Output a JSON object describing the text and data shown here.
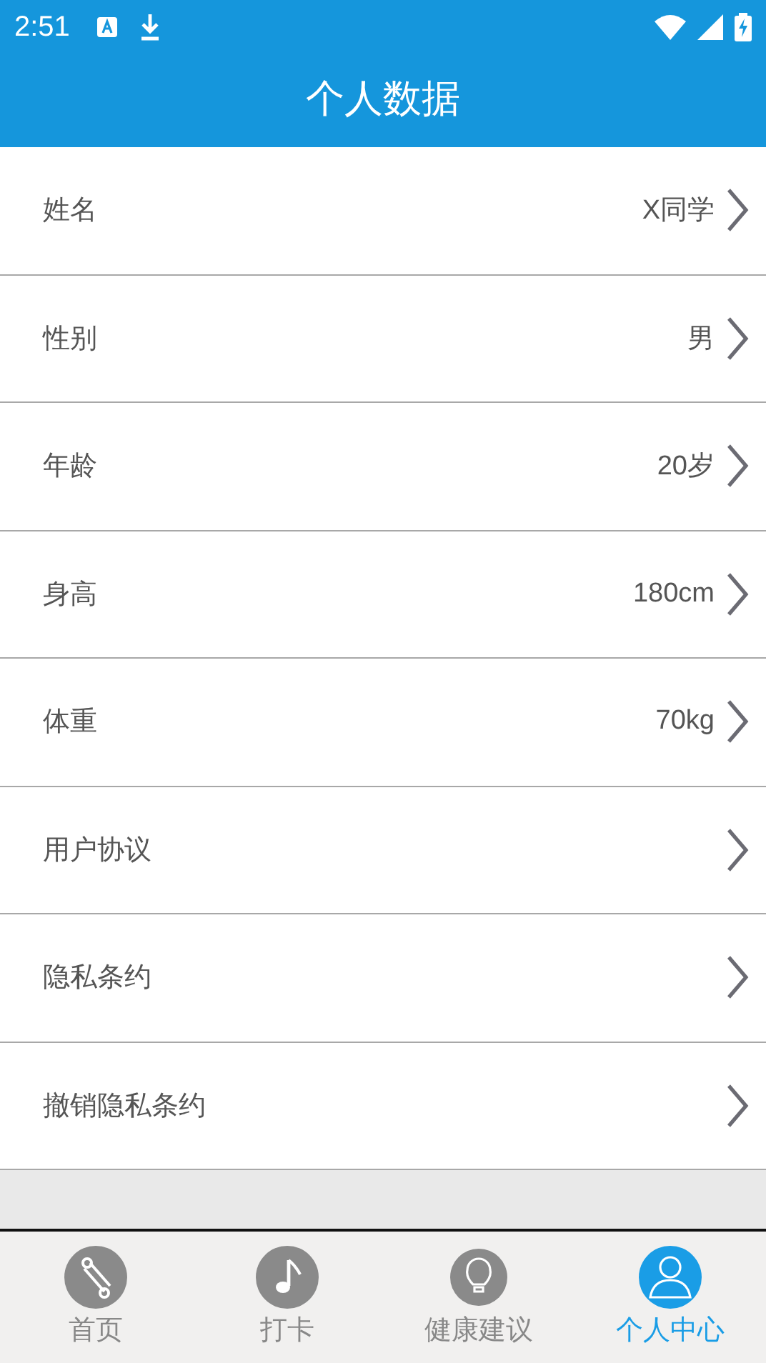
{
  "status_bar": {
    "time": "2:51"
  },
  "header": {
    "title": "个人数据"
  },
  "rows": [
    {
      "label": "姓名",
      "value": "X同学"
    },
    {
      "label": "性别",
      "value": "男"
    },
    {
      "label": "年龄",
      "value": "20岁"
    },
    {
      "label": "身高",
      "value": "180cm"
    },
    {
      "label": "体重",
      "value": "70kg"
    },
    {
      "label": "用户协议"
    },
    {
      "label": "隐私条约"
    },
    {
      "label": "撤销隐私条约"
    }
  ],
  "tabs": [
    {
      "label": "首页",
      "selected": false
    },
    {
      "label": "打卡",
      "selected": false
    },
    {
      "label": "健康建议",
      "selected": false
    },
    {
      "label": "个人中心",
      "selected": true
    }
  ]
}
